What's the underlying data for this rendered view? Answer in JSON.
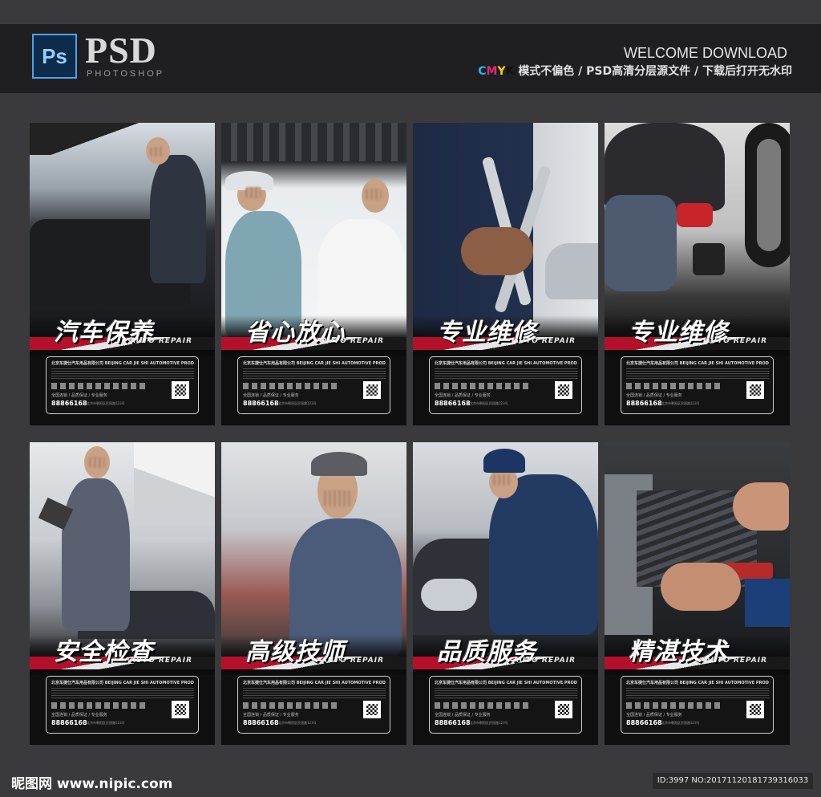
{
  "header": {
    "ps_icon": "Ps",
    "title": "PSD",
    "subtitle": "PHOTOSHOP",
    "welcome": "WELCOME DOWNLOAD",
    "cmyk": [
      "C",
      "M",
      "Y",
      "K"
    ],
    "tagline": "模式不偏色 / PSD高清分层源文件 / 下载后打开无水印"
  },
  "cards": [
    {
      "title": "汽车保养",
      "sub": "AUTO REPAIR"
    },
    {
      "title": "省心放心",
      "sub": "AUTO REPAIR"
    },
    {
      "title": "专业维修",
      "sub": "AUTO REPAIR"
    },
    {
      "title": "专业维修",
      "sub": "AUTO REPAIR"
    },
    {
      "title": "安全检查",
      "sub": "AUTO REPAIR"
    },
    {
      "title": "高级技师",
      "sub": "AUTO REPAIR"
    },
    {
      "title": "品质服务",
      "sub": "AUTO REPAIR"
    },
    {
      "title": "精湛技术",
      "sub": "AUTO REPAIR"
    }
  ],
  "info": {
    "company": "北京车捷仕汽车用品有限公司 BEIJING CAR JIE SHI AUTOMOTIVE PRODUCTS CO., LTD",
    "service": "全国连锁 / 品质保证 / 专业服务",
    "phone": "88866168",
    "address": "北京市朝阳区民国路123号"
  },
  "footer": {
    "logo": "昵图网 www.nipic.com",
    "id": "ID:3997 NO:20171120181739316033"
  }
}
